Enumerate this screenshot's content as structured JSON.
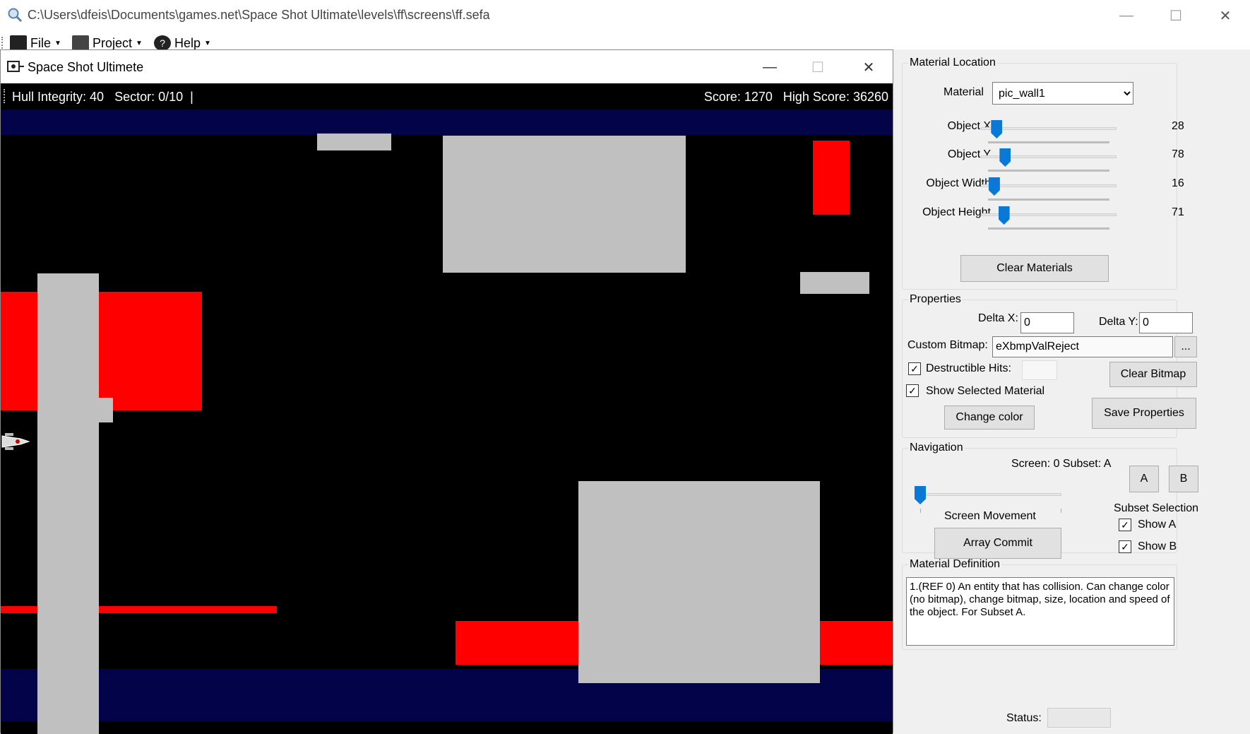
{
  "window": {
    "path": "C:\\Users\\dfeis\\Documents\\games.net\\Space Shot Ultimate\\levels\\ff\\screens\\ff.sefa",
    "minimize": "—",
    "maximize": "☐",
    "close": "✕"
  },
  "menu": {
    "file": "File",
    "project": "Project",
    "help": "Help"
  },
  "game": {
    "title": "Space Shot Ultimete",
    "hud_left": "Hull Integrity: 40   Sector: 0/10  |",
    "hud_right": "Score: 1270   High Score: 36260",
    "minimize": "—",
    "maximize": "☐",
    "close": "✕"
  },
  "material_location": {
    "legend": "Material Location",
    "material_label": "Material",
    "material_value": "pic_wall1",
    "sliders": [
      {
        "label": "Object X",
        "value": "28",
        "level": 0.06
      },
      {
        "label": "Object Y",
        "value": "78",
        "level": 0.13
      },
      {
        "label": "Object Width",
        "value": "16",
        "level": 0.04
      },
      {
        "label": "Object Height",
        "value": "71",
        "level": 0.12
      }
    ],
    "clear_button": "Clear Materials"
  },
  "properties": {
    "legend": "Properties",
    "delta_x_label": "Delta X:",
    "delta_x_value": "0",
    "delta_y_label": "Delta Y:",
    "delta_y_value": "0",
    "custom_bitmap_label": "Custom Bitmap:",
    "custom_bitmap_value": "eXbmpValReject",
    "browse_button": "...",
    "destructible_label": "Destructible Hits:",
    "destructible_checked": "✓",
    "show_selected_label": "Show Selected Material",
    "show_selected_checked": "✓",
    "clear_bitmap_button": "Clear Bitmap",
    "change_color_button": "Change color",
    "save_button": "Save Properties"
  },
  "navigation": {
    "legend": "Navigation",
    "screen_info": "Screen: 0 Subset: A",
    "button_a": "A",
    "button_b": "B",
    "screen_movement_label": "Screen Movement",
    "screen_level": 0.0,
    "subset_label": "Subset Selection",
    "show_a_label": "Show A",
    "show_a_checked": "✓",
    "show_b_label": "Show B",
    "show_b_checked": "✓",
    "array_commit_button": "Array Commit"
  },
  "material_definition": {
    "legend": "Material Definition",
    "text": "1.(REF 0) An entity that has collision. Can change color (no bitmap), change bitmap, size, location and speed of the object. For Subset A."
  },
  "status": {
    "label": "Status:"
  },
  "colors": {
    "wall_gray": "#c0c0c0",
    "hazard_red": "#ff0000",
    "border_navy": "#03034a",
    "accent_blue": "#0a78d7"
  }
}
